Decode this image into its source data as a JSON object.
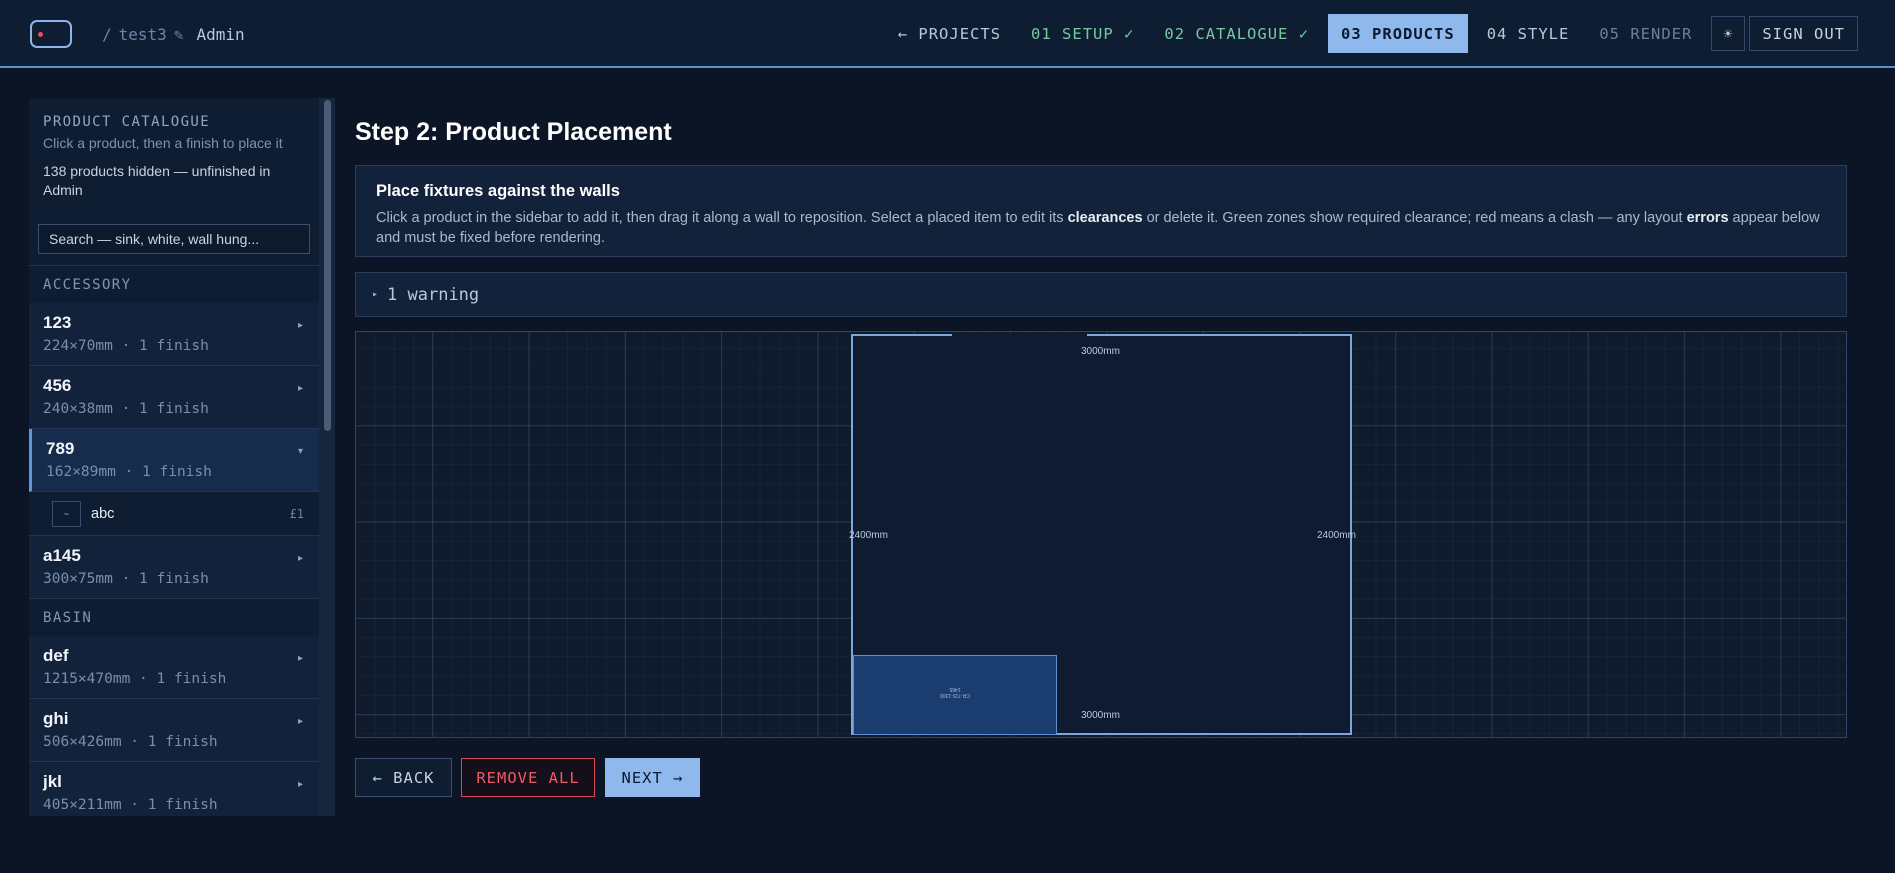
{
  "header": {
    "project_name": "test3",
    "edit_icon": "pencil-icon",
    "user_label": "Admin",
    "nav": {
      "projects": "← PROJECTS",
      "setup": "01 SETUP ✓",
      "catalogue": "02 CATALOGUE ✓",
      "products": "03 PRODUCTS",
      "style": "04 STYLE",
      "render": "05 RENDER",
      "theme_icon": "☀",
      "sign_out": "SIGN OUT"
    }
  },
  "sidebar": {
    "title": "PRODUCT CATALOGUE",
    "subtitle": "Click a product, then a finish to place it",
    "hidden_note": "138 products hidden — unfinished in Admin",
    "search_placeholder": "Search — sink, white, wall hung...",
    "categories": [
      {
        "name": "ACCESSORY",
        "products": [
          {
            "name": "123",
            "dims": "224×70mm · 1 finish",
            "chevron": "▸"
          },
          {
            "name": "456",
            "dims": "240×38mm · 1 finish",
            "chevron": "▸"
          },
          {
            "name": "789",
            "dims": "162×89mm · 1 finish",
            "chevron": "▾",
            "finish": {
              "swatch": "~",
              "name": "abc",
              "price": "£1"
            }
          },
          {
            "name": "a145",
            "dims": "300×75mm · 1 finish",
            "chevron": "▸"
          }
        ]
      },
      {
        "name": "BASIN",
        "products": [
          {
            "name": "def",
            "dims": "1215×470mm · 1 finish",
            "chevron": "▸"
          },
          {
            "name": "ghi",
            "dims": "506×426mm · 1 finish",
            "chevron": "▸"
          },
          {
            "name": "jkl",
            "dims": "405×211mm · 1 finish",
            "chevron": "▸"
          }
        ]
      }
    ]
  },
  "main": {
    "step_title": "Step 2: Product Placement",
    "info_title": "Place fixtures against the walls",
    "info_text_1": "Click a product in the sidebar to add it, then drag it along a wall to reposition. Select a placed item to edit its ",
    "info_bold_1": "clearances",
    "info_text_2": " or delete it. Green zones show required clearance; red means a clash — any layout ",
    "info_bold_2": "errors",
    "info_text_3": " appear below and must be fixed before rendering.",
    "warning_toggle": "▸",
    "warning_label": "1 warning",
    "room": {
      "top_dim": "3000mm",
      "bottom_dim": "3000mm",
      "left_dim": "2400mm",
      "right_dim": "2400mm",
      "fixture_label_1": "CR-715-1300",
      "fixture_label_2": "1465"
    }
  },
  "footer": {
    "back": "← BACK",
    "remove_all": "REMOVE ALL",
    "next": "NEXT →"
  },
  "colors": {
    "accent": "#8fb8ec",
    "done": "#77c9a0",
    "danger": "#ee5a61",
    "background": "#0b1525"
  }
}
